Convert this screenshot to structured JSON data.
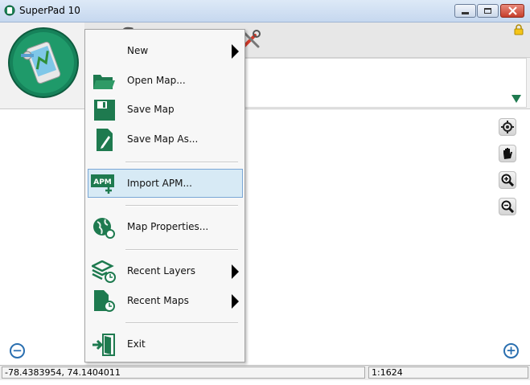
{
  "window": {
    "title": "SuperPad 10"
  },
  "colors": {
    "accent_green": "#1e7a4f",
    "menu_highlight": "#d7eaf5",
    "zoom_blue": "#2a6fb0"
  },
  "menu": {
    "items": [
      {
        "label": "New",
        "icon": "new-icon",
        "submenu": true
      },
      {
        "label": "Open Map...",
        "icon": "folder-open-icon"
      },
      {
        "label": "Save Map",
        "icon": "floppy-disk-icon"
      },
      {
        "label": "Save Map As...",
        "icon": "save-as-icon"
      },
      {
        "label": "Import APM...",
        "icon": "apm-import-icon",
        "highlighted": true
      },
      {
        "label": "Map Properties...",
        "icon": "globe-icon"
      },
      {
        "label": "Recent Layers",
        "icon": "layers-clock-icon",
        "submenu": true
      },
      {
        "label": "Recent Maps",
        "icon": "map-doc-clock-icon",
        "submenu": true
      },
      {
        "label": "Exit",
        "icon": "exit-door-icon"
      }
    ],
    "import_icon_text": "APM"
  },
  "map_tools": [
    "locate-icon",
    "pan-hand-icon",
    "zoom-in-icon",
    "zoom-out-icon"
  ],
  "status": {
    "coordinates": "-78.4383954, 74.1404011",
    "scale": "1:1624"
  }
}
